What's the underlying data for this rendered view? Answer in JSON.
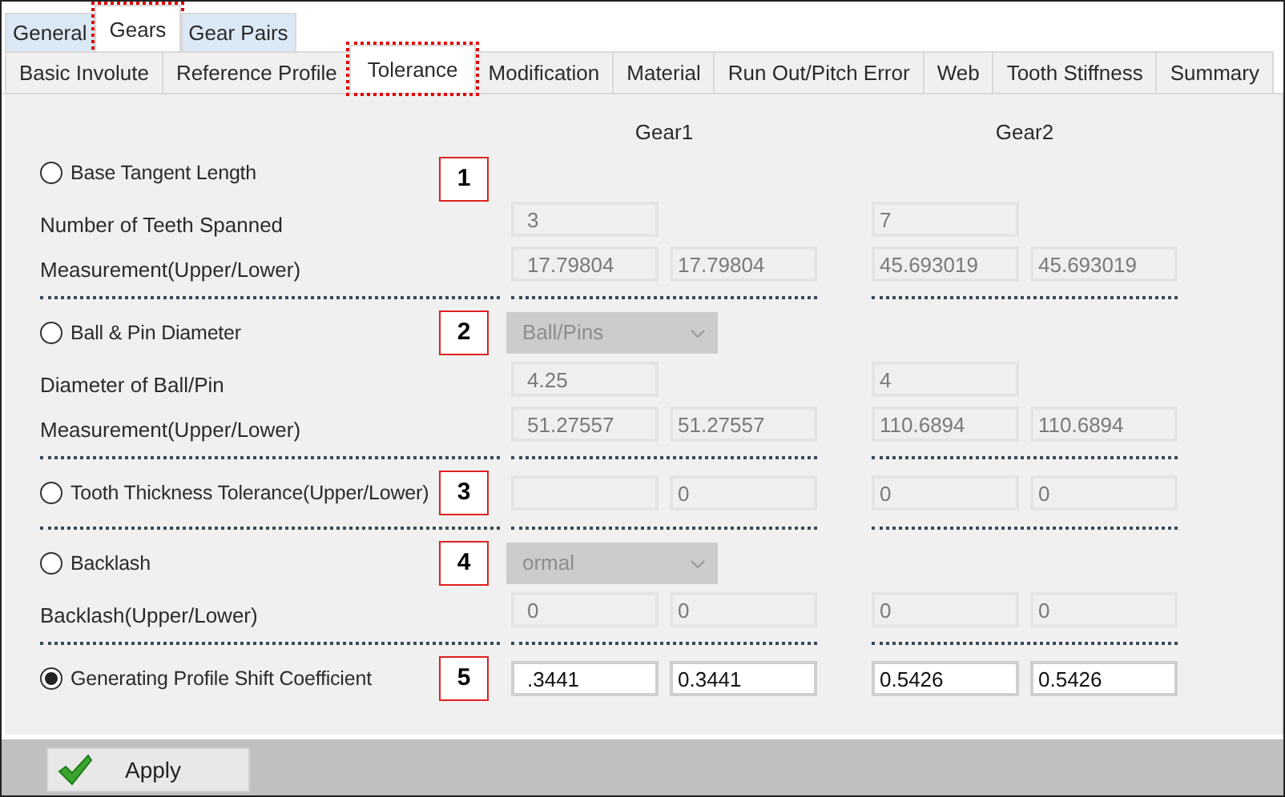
{
  "tabs": [
    {
      "label": "General",
      "selected": false,
      "highlighted": false
    },
    {
      "label": "Gears",
      "selected": true,
      "highlighted": true
    },
    {
      "label": "Gear Pairs",
      "selected": false,
      "highlighted": false
    }
  ],
  "subtabs": [
    {
      "label": "Basic Involute",
      "selected": false,
      "highlighted": false
    },
    {
      "label": "Reference Profile",
      "selected": false,
      "highlighted": false
    },
    {
      "label": "Tolerance",
      "selected": true,
      "highlighted": true
    },
    {
      "label": "Modification",
      "selected": false,
      "highlighted": false
    },
    {
      "label": "Material",
      "selected": false,
      "highlighted": false
    },
    {
      "label": "Run Out/Pitch Error",
      "selected": false,
      "highlighted": false
    },
    {
      "label": "Web",
      "selected": false,
      "highlighted": false
    },
    {
      "label": "Tooth Stiffness",
      "selected": false,
      "highlighted": false
    },
    {
      "label": "Summary",
      "selected": false,
      "highlighted": false
    }
  ],
  "columns": [
    "Gear1",
    "Gear2"
  ],
  "rows": [
    {
      "kind": "option",
      "label": "Base Tangent Length",
      "selected": false,
      "callout": "1"
    },
    {
      "kind": "param",
      "label": "Number of Teeth Spanned",
      "gear1": [
        {
          "value": "3",
          "disabled": true
        }
      ],
      "gear2": [
        {
          "value": "7",
          "disabled": true
        }
      ]
    },
    {
      "kind": "param",
      "label": "Measurement(Upper/Lower)",
      "gear1": [
        {
          "value": "17.79804",
          "disabled": true
        },
        {
          "value": "17.79804",
          "disabled": true
        }
      ],
      "gear2": [
        {
          "value": "45.693019",
          "disabled": true
        },
        {
          "value": "45.693019",
          "disabled": true
        }
      ]
    },
    {
      "kind": "divider"
    },
    {
      "kind": "option",
      "label": "Ball & Pin Diameter",
      "selected": false,
      "callout": "2",
      "dropdown": {
        "value": "Ball/Pins",
        "disabled": true
      }
    },
    {
      "kind": "param",
      "label": "Diameter of Ball/Pin",
      "gear1": [
        {
          "value": "4.25",
          "disabled": true
        }
      ],
      "gear2": [
        {
          "value": "4",
          "disabled": true
        }
      ]
    },
    {
      "kind": "param",
      "label": "Measurement(Upper/Lower)",
      "gear1": [
        {
          "value": "51.27557",
          "disabled": true
        },
        {
          "value": "51.27557",
          "disabled": true
        }
      ],
      "gear2": [
        {
          "value": "110.6894",
          "disabled": true
        },
        {
          "value": "110.6894",
          "disabled": true
        }
      ]
    },
    {
      "kind": "divider"
    },
    {
      "kind": "option",
      "label": "Tooth Thickness Tolerance(Upper/Lower)",
      "selected": false,
      "callout": "3",
      "gear1": [
        {
          "disabled": true
        },
        {
          "value": "0",
          "disabled": true
        }
      ],
      "gear2": [
        {
          "value": "0",
          "disabled": true
        },
        {
          "value": "0",
          "disabled": true
        }
      ]
    },
    {
      "kind": "divider"
    },
    {
      "kind": "option",
      "label": "Backlash",
      "selected": false,
      "callout": "4",
      "dropdown": {
        "value": "ormal",
        "disabled": true
      }
    },
    {
      "kind": "param",
      "label": "Backlash(Upper/Lower)",
      "gear1": [
        {
          "value": "0",
          "disabled": true
        },
        {
          "value": "0",
          "disabled": true
        }
      ],
      "gear2": [
        {
          "value": "0",
          "disabled": true
        },
        {
          "value": "0",
          "disabled": true
        }
      ]
    },
    {
      "kind": "divider"
    },
    {
      "kind": "option",
      "label": "Generating Profile Shift Coefficient",
      "selected": true,
      "callout": "5",
      "gear1": [
        {
          "value": ".3441",
          "disabled": false
        },
        {
          "value": "0.3441",
          "disabled": false
        }
      ],
      "gear2": [
        {
          "value": "0.5426",
          "disabled": false
        },
        {
          "value": "0.5426",
          "disabled": false
        }
      ]
    }
  ],
  "apply_button": {
    "label": "Apply"
  }
}
